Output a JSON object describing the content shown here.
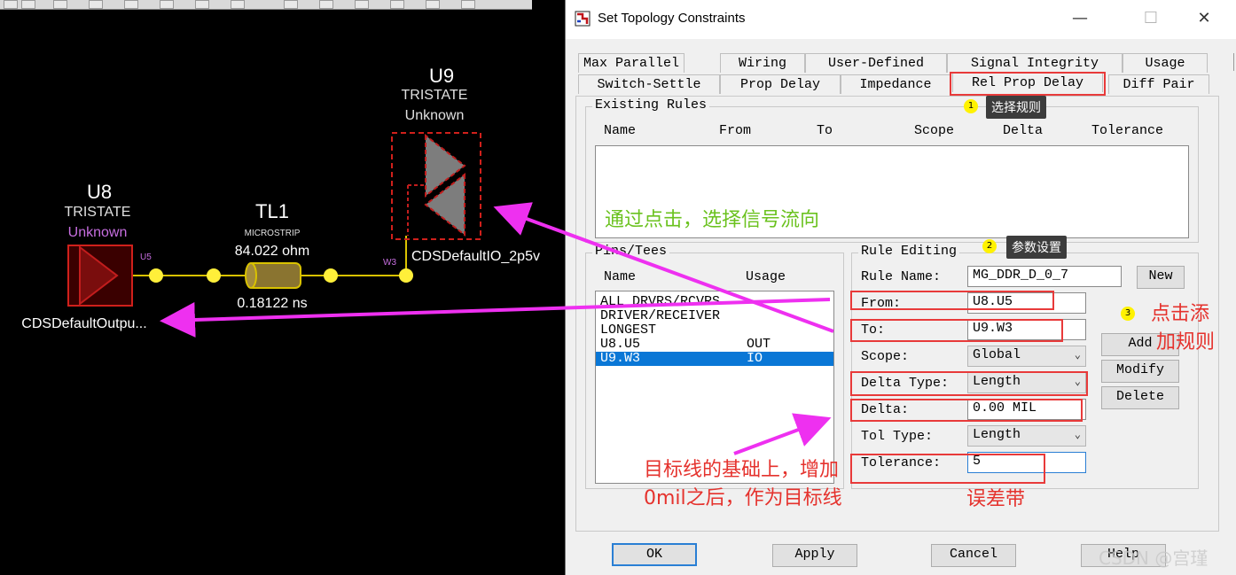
{
  "schematic": {
    "u8": {
      "ref": "U8",
      "type": "TRISTATE",
      "status": "Unknown",
      "pin": "U5",
      "model": "CDSDefaultOutpu..."
    },
    "tl1": {
      "ref": "TL1",
      "type": "MICROSTRIP",
      "impedance": "84.022 ohm",
      "delay": "0.18122 ns"
    },
    "u9": {
      "ref": "U9",
      "type": "TRISTATE",
      "status": "Unknown",
      "pin": "W3",
      "model": "CDSDefaultIO_2p5v"
    }
  },
  "dialog": {
    "title": "Set Topology Constraints",
    "tabs_row1": [
      "Max Parallel",
      "Wiring",
      "User-Defined",
      "Signal Integrity",
      "Usage"
    ],
    "tabs_row2": [
      "Switch-Settle",
      "Prop Delay",
      "Impedance",
      "Rel Prop Delay",
      "Diff Pair"
    ],
    "existing_rules": {
      "label": "Existing Rules",
      "columns": [
        "Name",
        "From",
        "To",
        "Scope",
        "Delta",
        "Tolerance"
      ]
    },
    "pins_tees": {
      "label": "Pins/Tees",
      "columns": [
        "Name",
        "Usage"
      ],
      "rows": [
        {
          "name": "ALL DRVRS/RCVRS",
          "usage": ""
        },
        {
          "name": "DRIVER/RECEIVER",
          "usage": ""
        },
        {
          "name": "LONGEST",
          "usage": ""
        },
        {
          "name": "U8.U5",
          "usage": "OUT"
        },
        {
          "name": "U9.W3",
          "usage": "IO"
        }
      ]
    },
    "rule_editing": {
      "label": "Rule Editing",
      "rule_name_label": "Rule Name:",
      "rule_name": "MG_DDR_D_0_7",
      "new_btn": "New",
      "from_label": "From:",
      "from": "U8.U5",
      "to_label": "To:",
      "to": "U9.W3",
      "scope_label": "Scope:",
      "scope": "Global",
      "delta_type_label": "Delta Type:",
      "delta_type": "Length",
      "delta_label": "Delta:",
      "delta": "0.00 MIL",
      "tol_type_label": "Tol Type:",
      "tol_type": "Length",
      "tolerance_label": "Tolerance:",
      "tolerance": "5",
      "add_btn": "Add",
      "modify_btn": "Modify",
      "delete_btn": "Delete"
    },
    "buttons": {
      "ok": "OK",
      "apply": "Apply",
      "cancel": "Cancel",
      "help": "Help"
    }
  },
  "annotations": {
    "n1": "1",
    "tip1": "选择规则",
    "n2": "2",
    "tip2": "参数设置",
    "n3": "3",
    "click_add_1": "点击添",
    "click_add_2": "加规则",
    "signal_flow": "通过点击，选择信号流向",
    "target_1": "目标线的基础上，增加",
    "target_2": "0mil之后，作为目标线",
    "tol_band": "误差带",
    "watermark": "CSDN @宫瑾"
  },
  "colors": {
    "accent": "#e83a3a",
    "selection": "#0a77d6",
    "annotation_arrow": "#ee30f0",
    "net_node": "#ffef3a"
  }
}
